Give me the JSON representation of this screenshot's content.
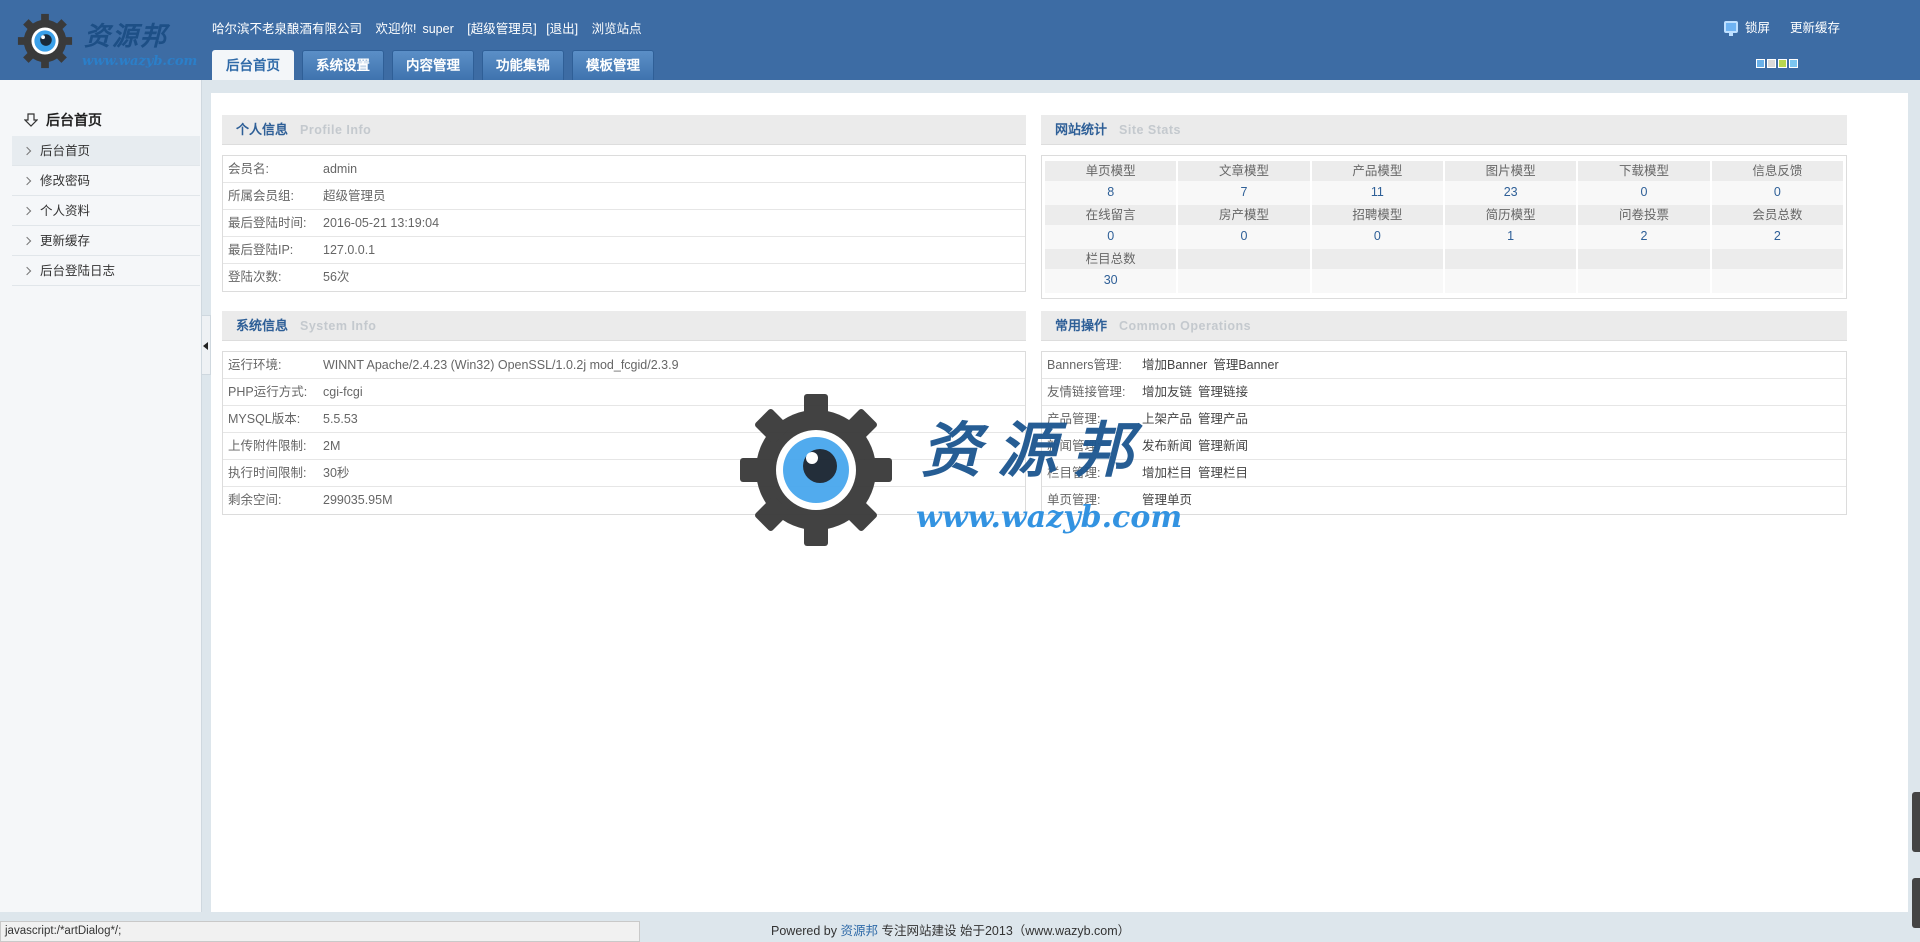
{
  "header": {
    "logo": {
      "title": "资源邦",
      "url": "www.wazyb.com"
    },
    "company": "哈尔滨不老泉酿酒有限公司",
    "welcome": "欢迎你!",
    "username": "super",
    "role": "[超级管理员]",
    "logout": "[退出]",
    "browse_site": "浏览站点",
    "tabs": [
      {
        "label": "后台首页",
        "active": true
      },
      {
        "label": "系统设置",
        "active": false
      },
      {
        "label": "内容管理",
        "active": false
      },
      {
        "label": "功能集锦",
        "active": false
      },
      {
        "label": "模板管理",
        "active": false
      }
    ],
    "lock_screen": "锁屏",
    "update_cache": "更新缓存",
    "skin_colors": [
      "#6ab0e8",
      "#d9d9d9",
      "#b8d84e",
      "#7cc6f0"
    ]
  },
  "sidebar": {
    "title": "后台首页",
    "items": [
      {
        "label": "后台首页",
        "active": true
      },
      {
        "label": "修改密码",
        "active": false
      },
      {
        "label": "个人资料",
        "active": false
      },
      {
        "label": "更新缓存",
        "active": false
      },
      {
        "label": "后台登陆日志",
        "active": false
      }
    ]
  },
  "profile": {
    "title": "个人信息",
    "title_en": "Profile  Info",
    "rows": [
      {
        "key": "会员名:",
        "value": "admin"
      },
      {
        "key": "所属会员组:",
        "value": "超级管理员"
      },
      {
        "key": "最后登陆时间:",
        "value": "2016-05-21 13:19:04"
      },
      {
        "key": "最后登陆IP:",
        "value": "127.0.0.1"
      },
      {
        "key": "登陆次数:",
        "value": "56次"
      }
    ]
  },
  "stats": {
    "title": "网站统计",
    "title_en": "Site  Stats",
    "cells": [
      {
        "label": "单页模型",
        "value": "8"
      },
      {
        "label": "文章模型",
        "value": "7"
      },
      {
        "label": "产品模型",
        "value": "11"
      },
      {
        "label": "图片模型",
        "value": "23"
      },
      {
        "label": "下载模型",
        "value": "0"
      },
      {
        "label": "信息反馈",
        "value": "0"
      },
      {
        "label": "在线留言",
        "value": "0"
      },
      {
        "label": "房产模型",
        "value": "0"
      },
      {
        "label": "招聘模型",
        "value": "0"
      },
      {
        "label": "简历模型",
        "value": "1"
      },
      {
        "label": "问卷投票",
        "value": "2"
      },
      {
        "label": "会员总数",
        "value": "2"
      },
      {
        "label": "栏目总数",
        "value": "30"
      }
    ]
  },
  "system": {
    "title": "系统信息",
    "title_en": "System  Info",
    "rows": [
      {
        "key": "运行环境:",
        "value": "WINNT Apache/2.4.23 (Win32) OpenSSL/1.0.2j mod_fcgid/2.3.9"
      },
      {
        "key": "PHP运行方式:",
        "value": "cgi-fcgi"
      },
      {
        "key": "MYSQL版本:",
        "value": "5.5.53"
      },
      {
        "key": "上传附件限制:",
        "value": "2M"
      },
      {
        "key": "执行时间限制:",
        "value": "30秒"
      },
      {
        "key": "剩余空间:",
        "value": "299035.95M"
      }
    ]
  },
  "operations": {
    "title": "常用操作",
    "title_en": "Common  Operations",
    "rows": [
      {
        "key": "Banners管理:",
        "ops": [
          "增加Banner",
          "管理Banner"
        ]
      },
      {
        "key": "友情链接管理:",
        "ops": [
          "增加友链",
          "管理链接"
        ]
      },
      {
        "key": "产品管理:",
        "ops": [
          "上架产品",
          "管理产品"
        ]
      },
      {
        "key": "新闻管理:",
        "ops": [
          "发布新闻",
          "管理新闻"
        ]
      },
      {
        "key": "栏目管理:",
        "ops": [
          "增加栏目",
          "管理栏目"
        ]
      },
      {
        "key": "单页管理:",
        "ops": [
          "管理单页"
        ]
      }
    ]
  },
  "footer": {
    "powered_prefix": "Powered by",
    "brand": "资源邦",
    "slogan": "专注网站建设  始于2013（www.wazyb.com）"
  },
  "statusbar": "javascript:/*artDialog*/;",
  "watermark": {
    "title": "资源邦",
    "url": "www.wazyb.com"
  }
}
